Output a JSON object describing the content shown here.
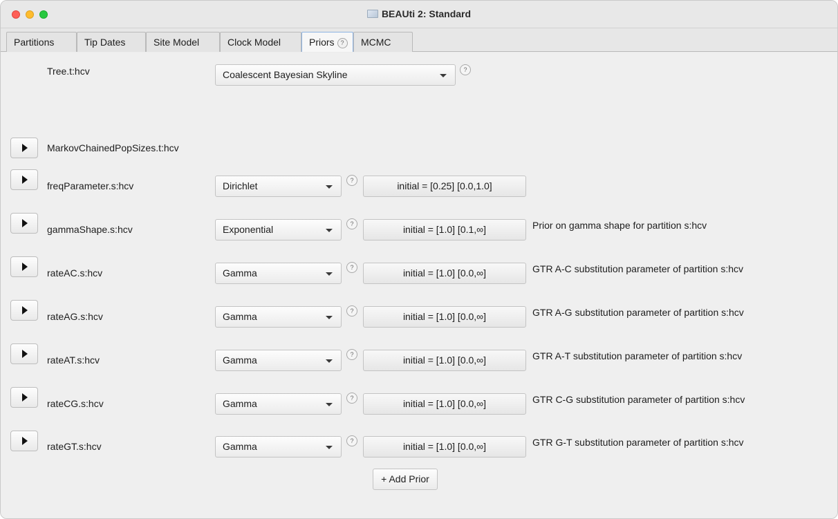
{
  "window": {
    "title": "BEAUti 2: Standard",
    "title_icon": "beauti-app-icon"
  },
  "tabs": [
    {
      "label": "Partitions",
      "active": false
    },
    {
      "label": "Tip Dates",
      "active": false
    },
    {
      "label": "Site Model",
      "active": false
    },
    {
      "label": "Clock Model",
      "active": false
    },
    {
      "label": "Priors",
      "active": true,
      "help": "?"
    },
    {
      "label": "MCMC",
      "active": false
    }
  ],
  "tree_prior": {
    "label": "Tree.t:hcv",
    "selected": "Coalescent Bayesian Skyline",
    "help": "?"
  },
  "pop_sizes": {
    "label": "MarkovChainedPopSizes.t:hcv"
  },
  "priors": [
    {
      "name": "freqParameter.s:hcv",
      "distribution": "Dirichlet",
      "initial": "initial = [0.25] [0.0,1.0]",
      "description": ""
    },
    {
      "name": "gammaShape.s:hcv",
      "distribution": "Exponential",
      "initial": "initial = [1.0] [0.1,∞]",
      "description": "Prior on gamma shape for partition s:hcv"
    },
    {
      "name": "rateAC.s:hcv",
      "distribution": "Gamma",
      "initial": "initial = [1.0] [0.0,∞]",
      "description": "GTR A-C substitution parameter of partition s:hcv"
    },
    {
      "name": "rateAG.s:hcv",
      "distribution": "Gamma",
      "initial": "initial = [1.0] [0.0,∞]",
      "description": "GTR A-G substitution parameter of partition s:hcv"
    },
    {
      "name": "rateAT.s:hcv",
      "distribution": "Gamma",
      "initial": "initial = [1.0] [0.0,∞]",
      "description": "GTR A-T substitution parameter of partition s:hcv"
    },
    {
      "name": "rateCG.s:hcv",
      "distribution": "Gamma",
      "initial": "initial = [1.0] [0.0,∞]",
      "description": "GTR C-G substitution parameter of partition s:hcv"
    },
    {
      "name": "rateGT.s:hcv",
      "distribution": "Gamma",
      "initial": "initial = [1.0] [0.0,∞]",
      "description": "GTR G-T substitution parameter of partition s:hcv"
    }
  ],
  "help_symbol": "?",
  "add_prior_label": "+ Add Prior"
}
